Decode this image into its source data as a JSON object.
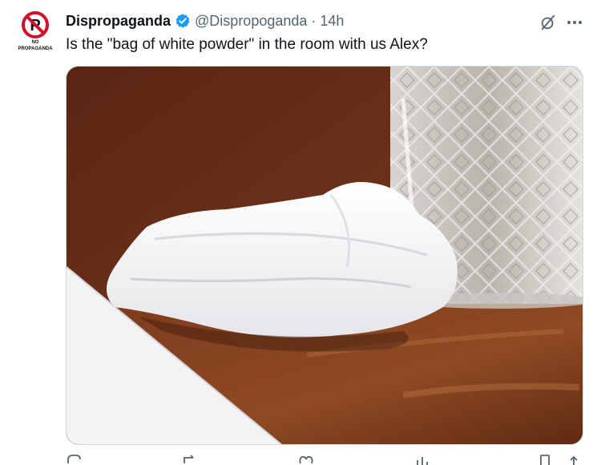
{
  "tweet": {
    "display_name": "Dispropaganda",
    "handle": "@Dispropoganda",
    "separator": "·",
    "time": "14h",
    "text": "Is the \"bag of white powder\" in the room with us Alex?",
    "avatar": {
      "icon": "no-propaganda-sign-icon",
      "caption": "NO PROPAGANDA"
    },
    "verified_badge_color": "#1d9bf0",
    "media": {
      "description_icon": "photo",
      "alt": ""
    }
  },
  "actions": {
    "icons": [
      "reply-icon",
      "repost-icon",
      "like-icon",
      "views-icon",
      "bookmark-icon",
      "share-icon"
    ]
  },
  "colors": {
    "text": "#0f1419",
    "secondary": "#536471",
    "accent": "#1d9bf0",
    "border": "#cfd9de"
  }
}
